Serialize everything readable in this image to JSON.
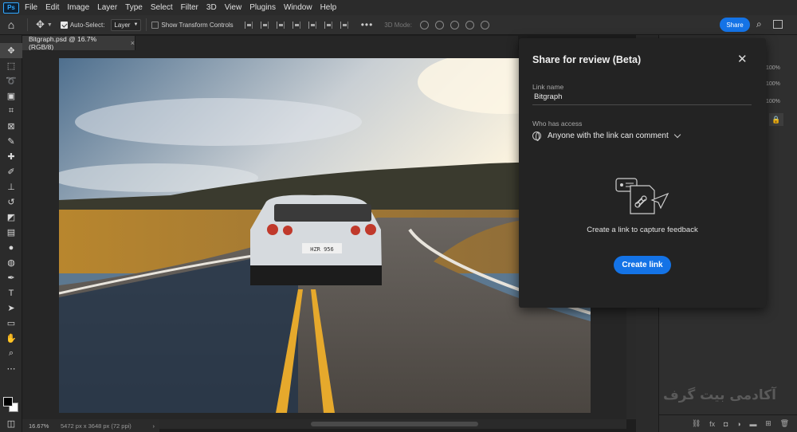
{
  "menubar": {
    "app_logo": "Ps",
    "items": [
      "File",
      "Edit",
      "Image",
      "Layer",
      "Type",
      "Select",
      "Filter",
      "3D",
      "View",
      "Plugins",
      "Window",
      "Help"
    ]
  },
  "options_bar": {
    "auto_select_label": "Auto-Select:",
    "auto_select_checked": true,
    "auto_select_target": "Layer",
    "show_transform_label": "Show Transform Controls",
    "show_transform_checked": false,
    "more_label": "•••",
    "mode_3d_label": "3D Mode:",
    "share_label": "Share"
  },
  "document": {
    "tab_title": "Bitgraph.psd @ 16.7% (RGB/8)",
    "close_glyph": "×"
  },
  "status_bar": {
    "zoom": "16.67%",
    "dimensions": "5472 px x 3648 px (72 ppi)"
  },
  "photo": {
    "license_plate": "HZR 956"
  },
  "layers_panel": {
    "opacity": "100%",
    "fill": "100%",
    "extra": "100%"
  },
  "share_dialog": {
    "title": "Share for review (Beta)",
    "close_glyph": "✕",
    "link_name_label": "Link name",
    "link_name_value": "Bitgraph",
    "access_label": "Who has access",
    "access_value": "Anyone with the link can comment",
    "capture_text": "Create a link to capture feedback",
    "create_button": "Create link"
  },
  "watermark": "آکادمی بیت گرف",
  "colors": {
    "accent": "#1473e6",
    "panel_bg": "#2f2f2f",
    "dialog_bg": "#232323"
  }
}
